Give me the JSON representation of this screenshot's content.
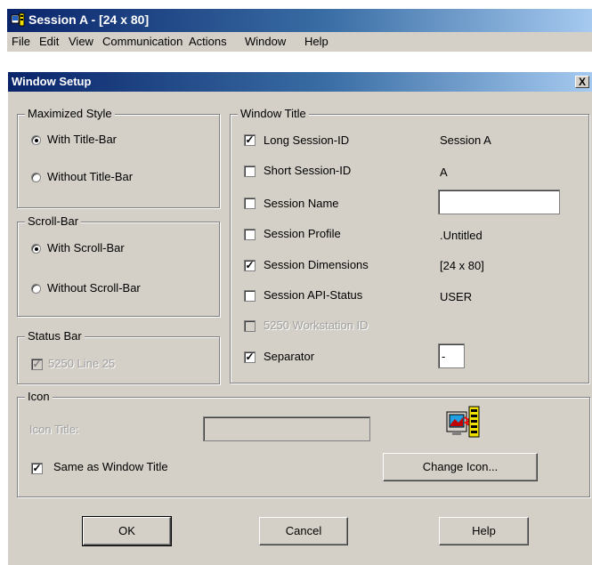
{
  "app": {
    "title": "Session A - [24 x 80]",
    "menu": [
      "File",
      "Edit",
      "View",
      "Communication",
      "Actions",
      "Window",
      "Help"
    ]
  },
  "dialog": {
    "title": "Window Setup",
    "close_label": "X",
    "maximized_style": {
      "legend": "Maximized Style",
      "with_title_bar": "With Title-Bar",
      "without_title_bar": "Without Title-Bar",
      "selected": "with_title_bar"
    },
    "scroll_bar": {
      "legend": "Scroll-Bar",
      "with_scroll_bar": "With Scroll-Bar",
      "without_scroll_bar": "Without Scroll-Bar",
      "selected": "with_scroll_bar"
    },
    "status_bar": {
      "legend": "Status Bar",
      "line25_label": "5250 Line 25",
      "line25_checked": true
    },
    "window_title": {
      "legend": "Window Title",
      "rows": [
        {
          "label": "Long Session-ID",
          "checked": true,
          "value": "Session A"
        },
        {
          "label": "Short Session-ID",
          "checked": false,
          "value": "A"
        },
        {
          "label": "Session Name",
          "checked": false,
          "input_value": ""
        },
        {
          "label": "Session Profile",
          "checked": false,
          "value": ".Untitled"
        },
        {
          "label": "Session Dimensions",
          "checked": true,
          "value": "[24 x 80]"
        },
        {
          "label": "Session API-Status",
          "checked": false,
          "value": "USER"
        },
        {
          "label": "5250 Workstation ID",
          "checked": false,
          "disabled": true
        },
        {
          "label": "Separator",
          "checked": true,
          "input_value": "-"
        }
      ]
    },
    "icon": {
      "legend": "Icon",
      "title_label": "Icon Title:",
      "title_value": "",
      "same_as_title_label": "Same as Window Title",
      "same_as_title_checked": true,
      "change_icon_label": "Change Icon..."
    },
    "buttons": {
      "ok": "OK",
      "cancel": "Cancel",
      "help": "Help"
    }
  }
}
